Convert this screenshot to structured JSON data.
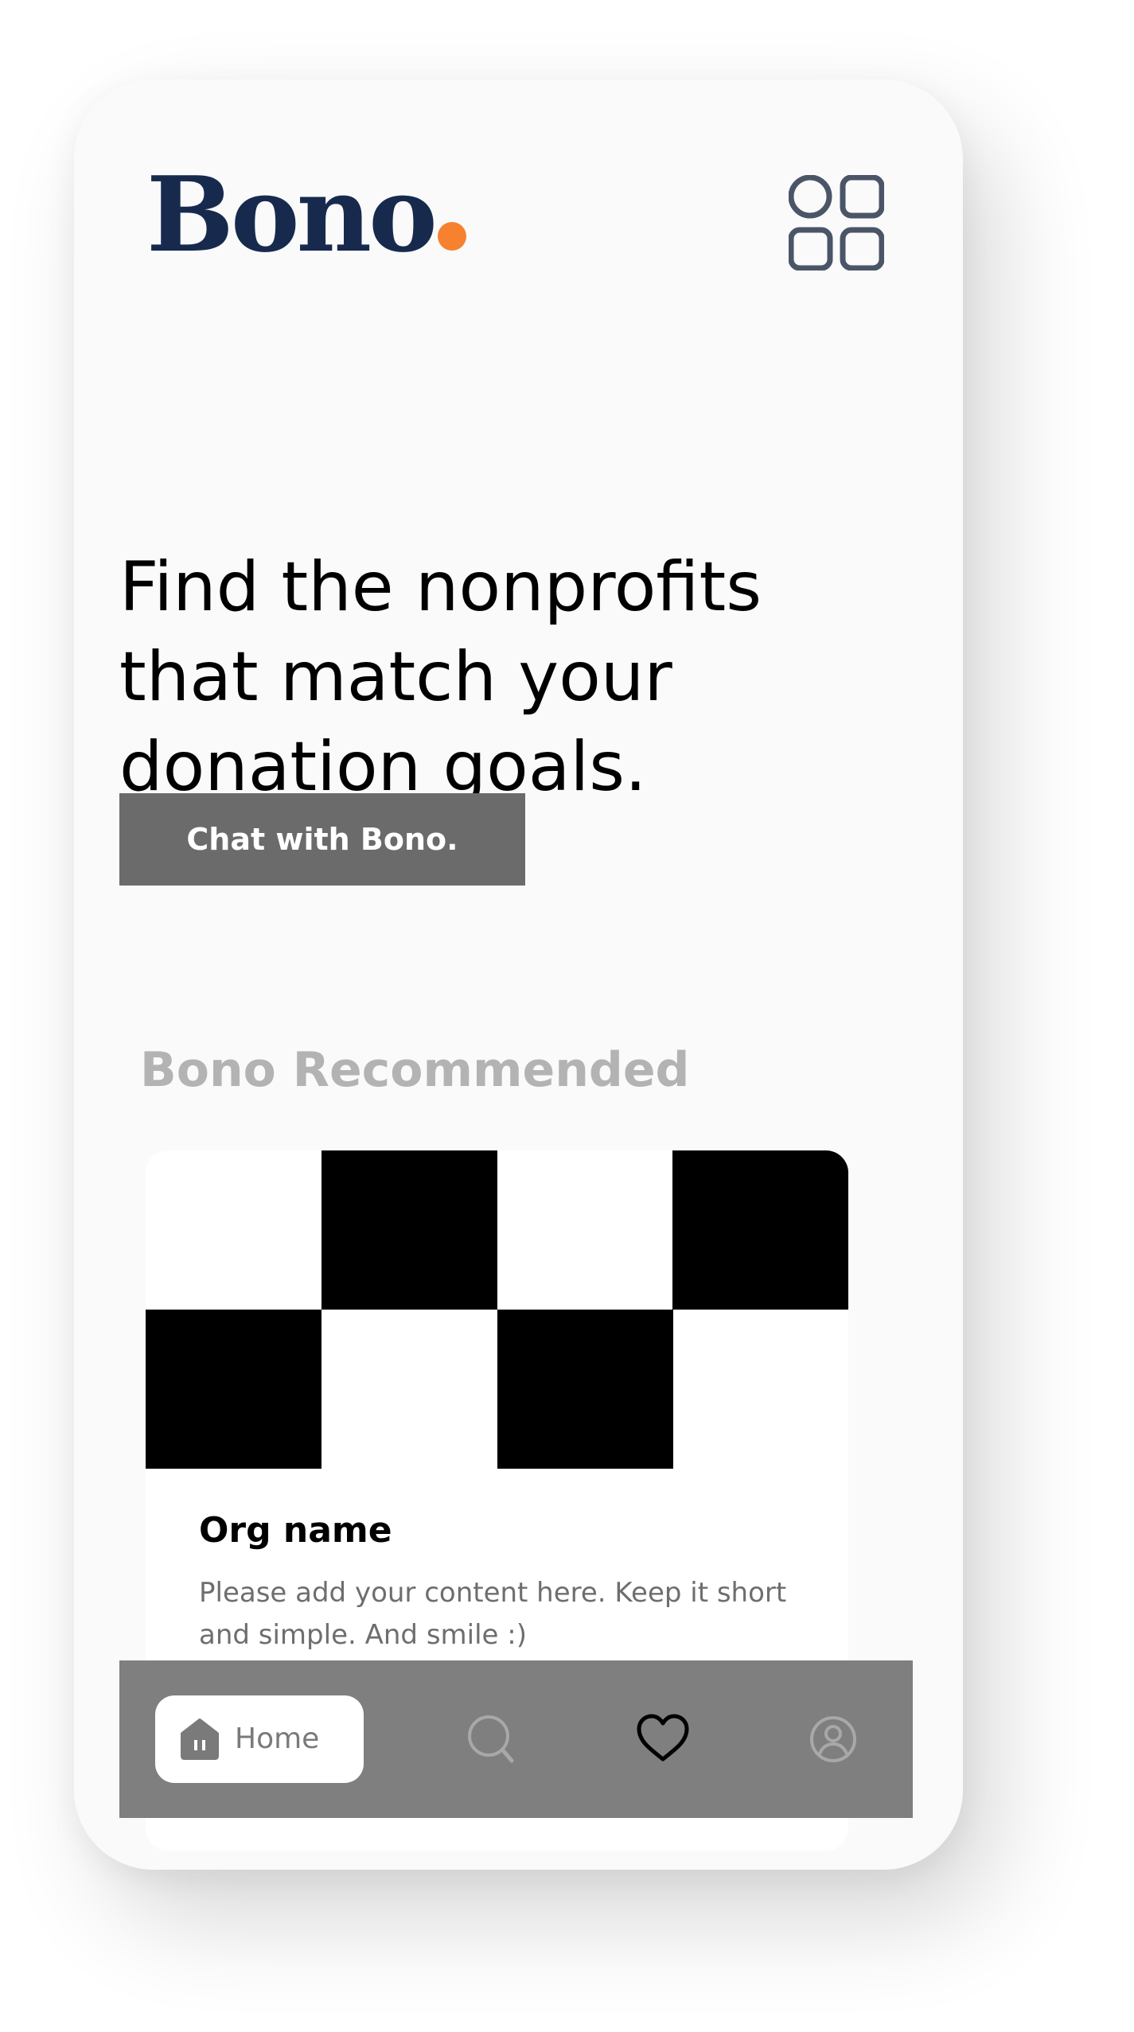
{
  "header": {
    "logo_text": "Bono",
    "menu_icon": "grid-menu-icon"
  },
  "hero": {
    "title": "Find the nonprofits that match your donation goals.",
    "cta_label": "Chat with Bono."
  },
  "recommended": {
    "section_title": "Bono Recommended",
    "card": {
      "image": "checkerboard-placeholder",
      "title": "Org name",
      "description": "Please add your content here. Keep it short and simple. And smile :)"
    }
  },
  "nav": {
    "items": [
      {
        "label": "Home",
        "icon": "home-icon",
        "active": true
      },
      {
        "label": "",
        "icon": "search-icon",
        "active": false
      },
      {
        "label": "",
        "icon": "heart-icon",
        "active": false
      },
      {
        "label": "",
        "icon": "profile-icon",
        "active": false
      }
    ]
  },
  "colors": {
    "brand_navy": "#172a4e",
    "brand_orange": "#f68230",
    "cta_background": "#6b6b6b",
    "nav_background": "#7f7f7f",
    "section_title": "#b3b3b3"
  }
}
